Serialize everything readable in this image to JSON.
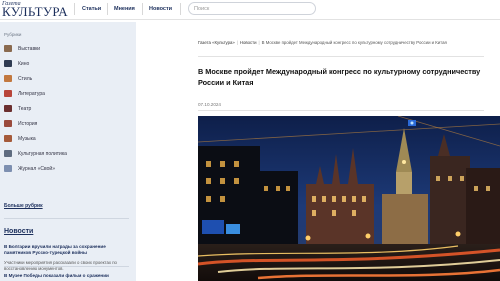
{
  "header": {
    "logo_small": "Газета",
    "logo_big": "КУЛЬТУРА",
    "nav": [
      "Статьи",
      "Мнения",
      "Новости"
    ],
    "search_placeholder": "Поиск"
  },
  "sidebar": {
    "title": "Рубрики",
    "items": [
      {
        "label": "Выставки",
        "icon": "exhibition-icon"
      },
      {
        "label": "Кино",
        "icon": "cinema-icon"
      },
      {
        "label": "Стиль",
        "icon": "style-icon"
      },
      {
        "label": "Литература",
        "icon": "literature-icon"
      },
      {
        "label": "Театр",
        "icon": "theatre-icon"
      },
      {
        "label": "История",
        "icon": "history-icon"
      },
      {
        "label": "Музыка",
        "icon": "music-icon"
      },
      {
        "label": "Культурная политика",
        "icon": "cultural-policy-icon"
      },
      {
        "label": "Журнал «Свой»",
        "icon": "magazine-icon"
      }
    ],
    "more_link": "Больше рубрик",
    "news_heading": "Новости",
    "news": [
      {
        "title": "В Болгарии вручили награды за сохранение памятников Русско-турецкой войны",
        "text": "Участники мероприятия рассказали о своих проектах по восстановлению монументов."
      },
      {
        "title": "В Музее Победы показали фильм о сражении"
      }
    ]
  },
  "article": {
    "breadcrumbs": [
      "Газета «Культура»",
      "Новости",
      "В Москве пройдет Международный конгресс по культурному сотрудничеству России и Китая"
    ],
    "headline": "В Москве пройдет Международный конгресс по культурному сотрудничеству России и Китая",
    "date": "07.10.2024"
  },
  "colors": {
    "brand": "#1c2f5c",
    "sidebar_bg": "#e9eef5"
  }
}
